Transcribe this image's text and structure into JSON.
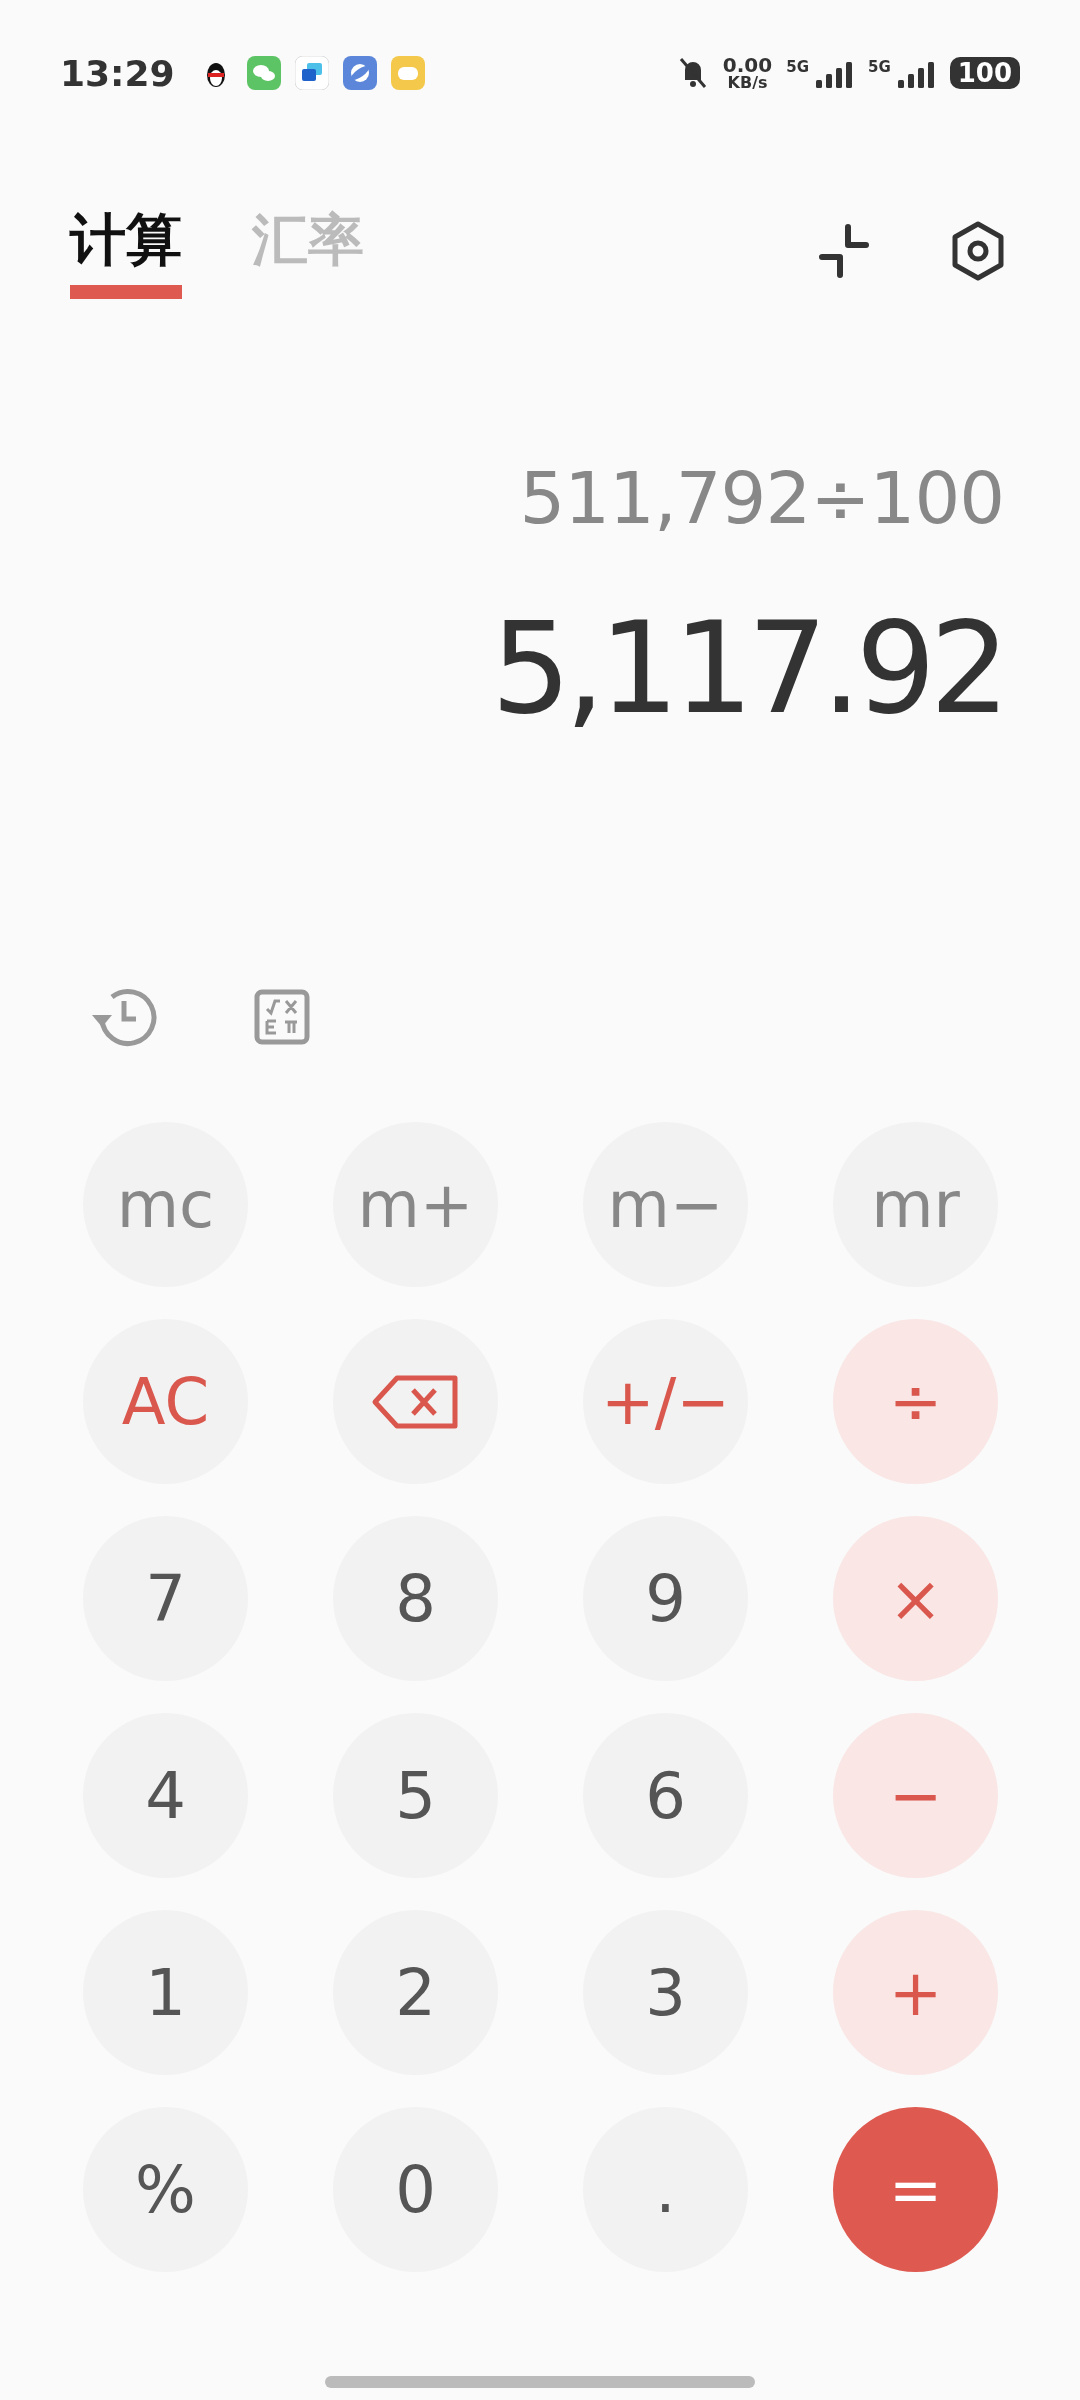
{
  "status_bar": {
    "time": "13:29",
    "speed_value": "0.00",
    "speed_unit": "KB/s",
    "networks": [
      "5G",
      "5G"
    ],
    "battery": "100"
  },
  "tabs": [
    {
      "label": "计算",
      "selected": true
    },
    {
      "label": "汇率",
      "selected": false
    }
  ],
  "display": {
    "expression": "511,792÷100",
    "result": "5,117.92"
  },
  "keys": [
    {
      "label": "mc",
      "kind": "memory"
    },
    {
      "label": "m+",
      "kind": "memory"
    },
    {
      "label": "m−",
      "kind": "memory"
    },
    {
      "label": "mr",
      "kind": "memory"
    },
    {
      "label": "AC",
      "kind": "function"
    },
    {
      "kind": "backspace"
    },
    {
      "label": "+/−",
      "kind": "function"
    },
    {
      "label": "÷",
      "kind": "operator"
    },
    {
      "label": "7",
      "kind": "digit"
    },
    {
      "label": "8",
      "kind": "digit"
    },
    {
      "label": "9",
      "kind": "digit"
    },
    {
      "label": "×",
      "kind": "operator"
    },
    {
      "label": "4",
      "kind": "digit"
    },
    {
      "label": "5",
      "kind": "digit"
    },
    {
      "label": "6",
      "kind": "digit"
    },
    {
      "label": "−",
      "kind": "operator"
    },
    {
      "label": "1",
      "kind": "digit"
    },
    {
      "label": "2",
      "kind": "digit"
    },
    {
      "label": "3",
      "kind": "digit"
    },
    {
      "label": "+",
      "kind": "operator"
    },
    {
      "label": "%",
      "kind": "digit"
    },
    {
      "label": "0",
      "kind": "digit"
    },
    {
      "label": ".",
      "kind": "digit"
    },
    {
      "label": "=",
      "kind": "equals"
    }
  ]
}
